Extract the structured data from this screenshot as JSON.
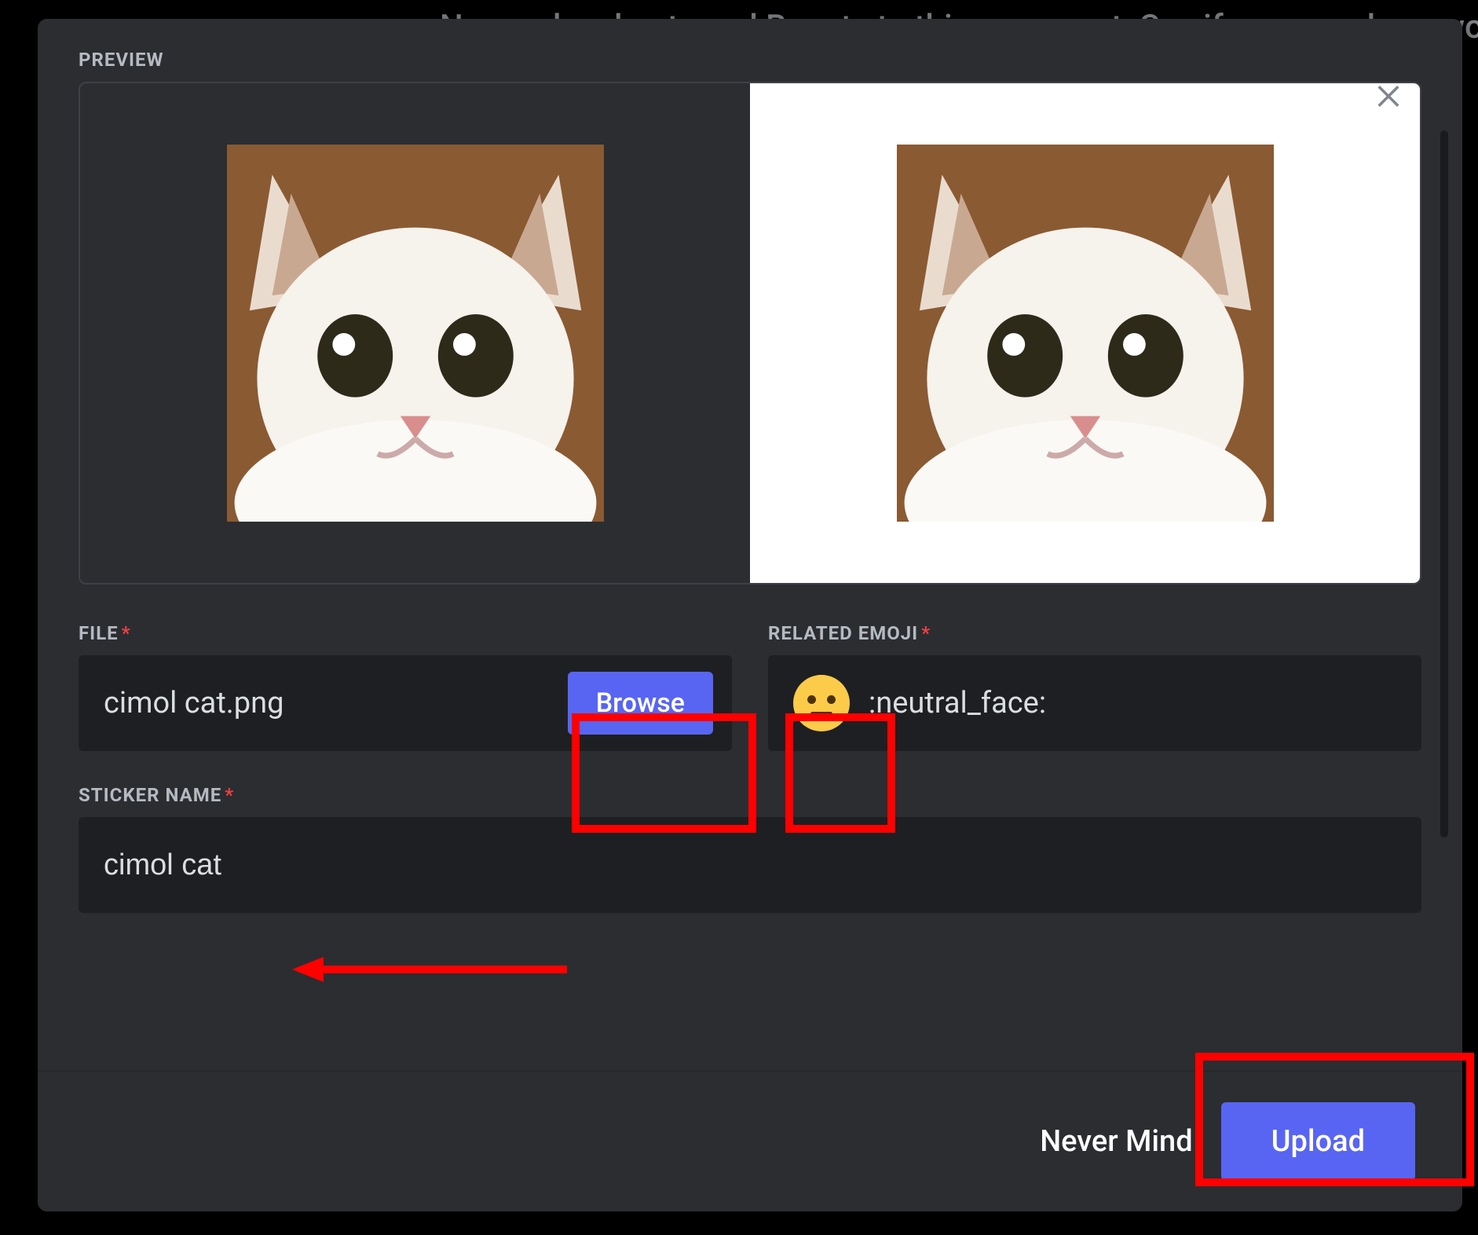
{
  "background": {
    "text": "No one has bestowed Boosts to this server yet. See if any members would"
  },
  "modal": {
    "preview_label": "PREVIEW",
    "file": {
      "label": "FILE",
      "value": "cimol cat.png",
      "browse": "Browse"
    },
    "emoji": {
      "label": "RELATED EMOJI",
      "name": ":neutral_face:",
      "semantic": "neutral_face"
    },
    "sticker_name": {
      "label": "STICKER NAME",
      "value": "cimol cat"
    },
    "footer": {
      "cancel": "Never Mind",
      "confirm": "Upload"
    }
  },
  "colors": {
    "accent": "#5865f2",
    "danger": "#f23f43",
    "bg_modal": "#2b2d31",
    "bg_input": "#1e1f22"
  },
  "annotations": {
    "highlight_browse": true,
    "highlight_emoji": true,
    "highlight_upload": true,
    "arrow_to_name": true
  }
}
